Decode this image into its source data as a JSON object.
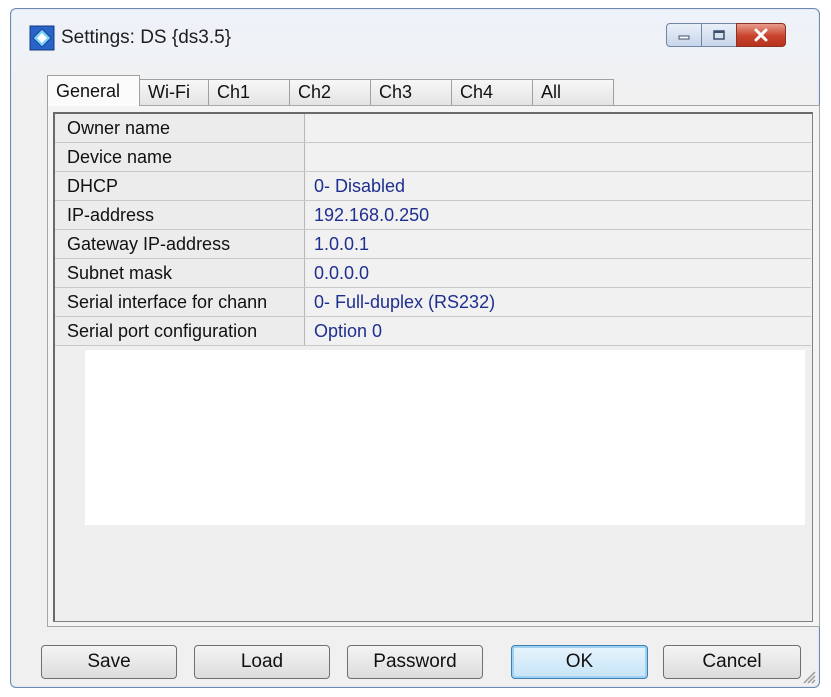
{
  "window": {
    "title": "Settings: DS {ds3.5}",
    "icon": "settings-app-icon",
    "controls": [
      "minimize-icon",
      "maximize-icon",
      "close-icon"
    ]
  },
  "tabs": [
    {
      "label": "General",
      "active": true
    },
    {
      "label": "Wi-Fi",
      "active": false
    },
    {
      "label": "Ch1",
      "active": false
    },
    {
      "label": "Ch2",
      "active": false
    },
    {
      "label": "Ch3",
      "active": false
    },
    {
      "label": "Ch4",
      "active": false
    },
    {
      "label": "All",
      "active": false
    }
  ],
  "properties": [
    {
      "label": "Owner name",
      "value": ""
    },
    {
      "label": "Device name",
      "value": ""
    },
    {
      "label": "DHCP",
      "value": "0- Disabled"
    },
    {
      "label": "IP-address",
      "value": "192.168.0.250"
    },
    {
      "label": "Gateway IP-address",
      "value": "1.0.0.1"
    },
    {
      "label": "Subnet mask",
      "value": "0.0.0.0"
    },
    {
      "label": "Serial interface for chann",
      "value": "0- Full-duplex (RS232)"
    },
    {
      "label": "Serial port configuration",
      "value": "Option 0"
    }
  ],
  "buttons": {
    "save": "Save",
    "load": "Load",
    "password": "Password",
    "ok": "OK",
    "cancel": "Cancel"
  },
  "colors": {
    "value_text": "#1f2f8f",
    "close_button": "#c8432c"
  }
}
